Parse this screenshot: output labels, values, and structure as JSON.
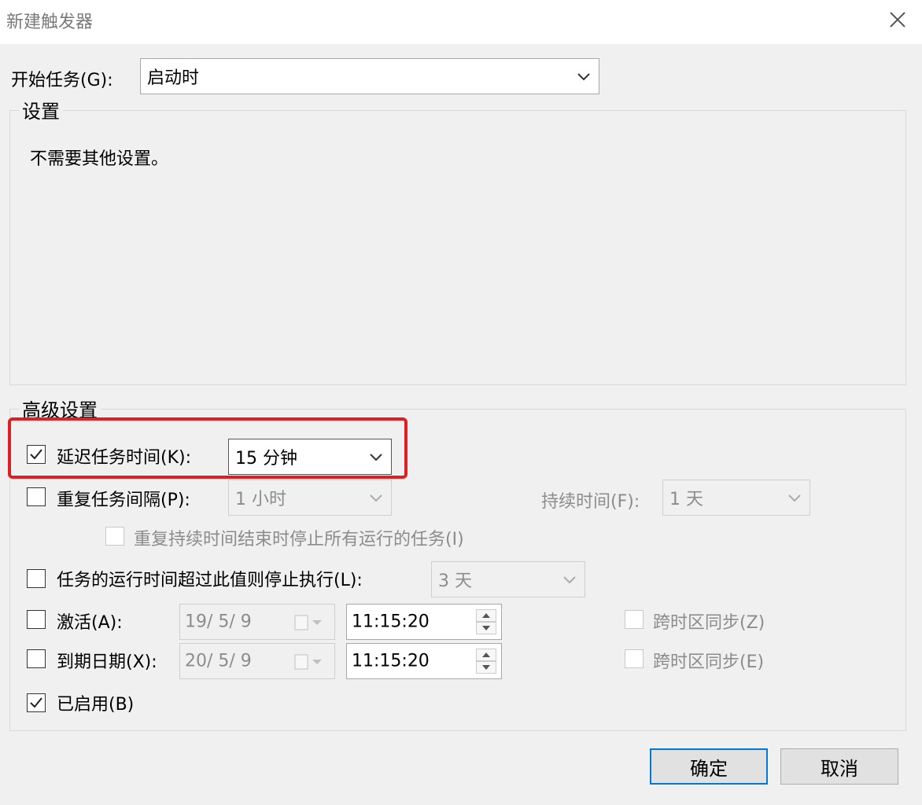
{
  "window": {
    "title": "新建触发器",
    "close_icon": "close-icon"
  },
  "begin_task": {
    "label": "开始任务(G):",
    "selected": "启动时"
  },
  "settings": {
    "title": "设置",
    "message": "不需要其他设置。"
  },
  "advanced": {
    "title": "高级设置",
    "delay": {
      "label": "延迟任务时间(K):",
      "checked": true,
      "value": "15 分钟"
    },
    "repeat": {
      "label": "重复任务间隔(P):",
      "checked": false,
      "value": "1 小时",
      "duration_label": "持续时间(F):",
      "duration_value": "1 天"
    },
    "stop_all": {
      "label": "重复持续时间结束时停止所有运行的任务(I)",
      "checked": false
    },
    "stop_if_longer": {
      "label": "任务的运行时间超过此值则停止执行(L):",
      "checked": false,
      "value": "3 天"
    },
    "activate": {
      "label": "激活(A):",
      "checked": false,
      "date": "19/  5/  9",
      "time": "11:15:20",
      "sync_label": "跨时区同步(Z)",
      "sync_checked": false
    },
    "expire": {
      "label": "到期日期(X):",
      "checked": false,
      "date": "20/  5/  9",
      "time": "11:15:20",
      "sync_label": "跨时区同步(E)",
      "sync_checked": false
    },
    "enabled": {
      "label": "已启用(B)",
      "checked": true
    }
  },
  "buttons": {
    "ok": "确定",
    "cancel": "取消"
  },
  "colors": {
    "highlight": "#e02020",
    "default_button_border": "#0078d7"
  }
}
